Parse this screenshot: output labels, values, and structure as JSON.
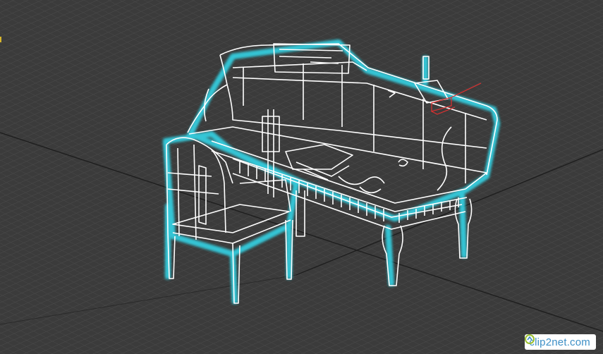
{
  "viewport": {
    "grid_color": "#4a4a4a",
    "background_color": "#3b3b3b",
    "wireframe_color": "#ffffff",
    "selection_glow_color": "#34d6e8",
    "gizmo_color": "#e03030"
  },
  "watermark": {
    "text": "clip2net.com",
    "icon": "clip2net-logo"
  }
}
